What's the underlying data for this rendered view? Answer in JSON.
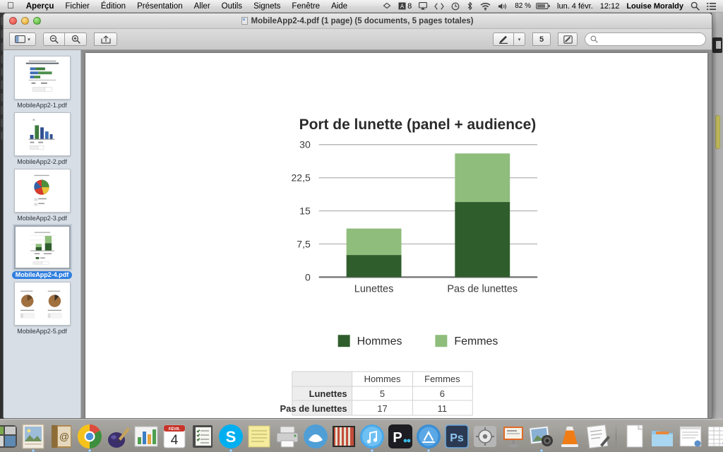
{
  "menubar": {
    "apple_icon": "apple-logo-icon",
    "items": [
      {
        "label": "Aperçu",
        "bold": true
      },
      {
        "label": "Fichier",
        "bold": false
      },
      {
        "label": "Édition",
        "bold": false
      },
      {
        "label": "Présentation",
        "bold": false
      },
      {
        "label": "Aller",
        "bold": false
      },
      {
        "label": "Outils",
        "bold": false
      },
      {
        "label": "Signets",
        "bold": false
      },
      {
        "label": "Fenêtre",
        "bold": false
      },
      {
        "label": "Aide",
        "bold": false
      }
    ],
    "status": {
      "dropbox_icon": "dropbox-icon",
      "app_badge_icon": "app-badge-icon",
      "app_badge_count": "8",
      "airplay_icon": "airplay-icon",
      "shortcut_icon": "shortcut-arrows-icon",
      "timemachine_icon": "time-machine-icon",
      "bluetooth_icon": "bluetooth-icon",
      "wifi_icon": "wifi-icon",
      "volume_icon": "volume-icon",
      "battery_percent": "82 %",
      "battery_icon": "battery-icon",
      "date": "lun. 4 févr.",
      "time": "12:12",
      "user": "Louise Moraldy",
      "spotlight_icon": "search-icon",
      "notification_icon": "notification-center-icon"
    }
  },
  "window": {
    "title": "MobileApp2-4.pdf (1 page) (5 documents, 5 pages totales)",
    "traffic": {
      "close": "close-button",
      "minimize": "minimize-button",
      "zoom": "zoom-button"
    },
    "toolbar": {
      "sidebar_icon": "sidebar-toggle-icon",
      "sidebar_arrow": "▾",
      "zoom_out_icon": "zoom-out-icon",
      "zoom_in_icon": "zoom-in-icon",
      "share_icon": "share-icon",
      "pen_icon": "pen-icon",
      "pen_arrow": "▾",
      "page_number": "5",
      "highlight_icon": "highlight-icon",
      "search_placeholder": "",
      "search_value": "",
      "search_icon": "search-icon"
    }
  },
  "sidebar": {
    "thumbnails": [
      {
        "label": "MobileApp2-1.pdf",
        "type": "hbar",
        "selected": false
      },
      {
        "label": "MobileApp2-2.pdf",
        "type": "vbar",
        "selected": false
      },
      {
        "label": "MobileApp2-3.pdf",
        "type": "pie",
        "selected": false
      },
      {
        "label": "MobileApp2-4.pdf",
        "type": "stacked",
        "selected": true
      },
      {
        "label": "MobileApp2-5.pdf",
        "type": "twopie",
        "selected": false
      }
    ]
  },
  "chart_data": {
    "type": "bar",
    "stacked": true,
    "title": "Port de lunette (panel + audience)",
    "xlabel": "",
    "ylabel": "",
    "categories": [
      "Lunettes",
      "Pas de lunettes"
    ],
    "series": [
      {
        "name": "Hommes",
        "values": [
          5,
          17
        ],
        "color": "#2f5e2c"
      },
      {
        "name": "Femmes",
        "values": [
          6,
          11
        ],
        "color": "#8fbd7c"
      }
    ],
    "totals": [
      11,
      28
    ],
    "ylim": [
      0,
      30
    ],
    "yticks": [
      "0",
      "7,5",
      "15",
      "22,5",
      "30"
    ],
    "ytick_values": [
      0,
      7.5,
      15,
      22.5,
      30
    ],
    "grid": true,
    "legend_position": "bottom",
    "legend": [
      "Hommes",
      "Femmes"
    ]
  },
  "table": {
    "columns": [
      "",
      "Hommes",
      "Femmes"
    ],
    "rows": [
      {
        "header": "Lunettes",
        "cells": [
          "5",
          "6"
        ]
      },
      {
        "header": "Pas de lunettes",
        "cells": [
          "17",
          "11"
        ]
      }
    ]
  },
  "dock": {
    "items": [
      {
        "name": "finder-icon",
        "running": true
      },
      {
        "name": "launchpad-icon",
        "running": false
      },
      {
        "name": "mission-control-icon",
        "running": false
      },
      {
        "name": "preview-icon",
        "running": true
      },
      {
        "name": "contacts-icon",
        "running": false
      },
      {
        "name": "chrome-icon",
        "running": true
      },
      {
        "name": "ink-icon",
        "running": false
      },
      {
        "name": "numbers-icon",
        "running": false
      },
      {
        "name": "calendar-icon",
        "running": false,
        "day": "4",
        "month": "FÉVR."
      },
      {
        "name": "reminders-icon",
        "running": false
      },
      {
        "name": "skype-icon",
        "running": true
      },
      {
        "name": "notes-icon",
        "running": false
      },
      {
        "name": "printer-icon",
        "running": false
      },
      {
        "name": "openoffice-icon",
        "running": false
      },
      {
        "name": "keynote-icon",
        "running": false
      },
      {
        "name": "itunes-icon",
        "running": true
      },
      {
        "name": "prezi-icon",
        "running": false
      },
      {
        "name": "app-store-icon",
        "running": true
      },
      {
        "name": "photoshop-icon",
        "running": false
      },
      {
        "name": "system-preferences-icon",
        "running": false
      },
      {
        "name": "presentation-icon",
        "running": false
      },
      {
        "name": "iphoto-icon",
        "running": true
      },
      {
        "name": "vlc-icon",
        "running": false
      },
      {
        "name": "textedit-icon",
        "running": false
      }
    ],
    "stack_items": [
      {
        "name": "document-stack-icon"
      },
      {
        "name": "downloads-folder-icon"
      },
      {
        "name": "document-window-icon"
      },
      {
        "name": "spreadsheet-window-icon"
      },
      {
        "name": "form-window-icon"
      },
      {
        "name": "trash-icon"
      }
    ]
  }
}
